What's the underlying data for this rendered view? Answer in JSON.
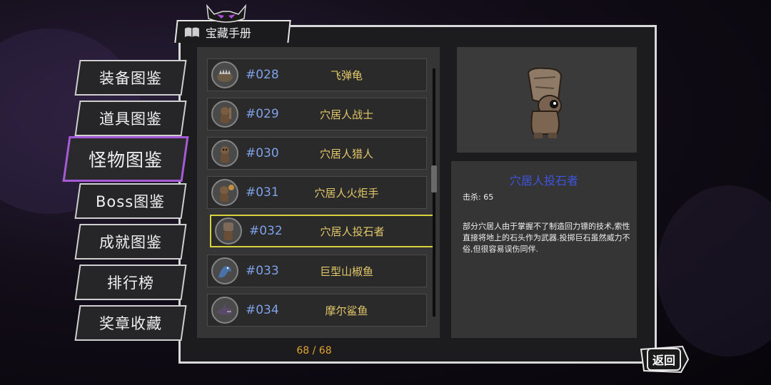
{
  "header": {
    "title": "宝藏手册"
  },
  "nav": {
    "items": [
      {
        "label": "装备图鉴",
        "active": false
      },
      {
        "label": "道具图鉴",
        "active": false
      },
      {
        "label": "怪物图鉴",
        "active": true
      },
      {
        "label": "Boss图鉴",
        "active": false
      },
      {
        "label": "成就图鉴",
        "active": false
      },
      {
        "label": "排行榜",
        "active": false
      },
      {
        "label": "奖章收藏",
        "active": false
      }
    ]
  },
  "monster_list": {
    "rows": [
      {
        "number": "#028",
        "name": "飞弹龟",
        "icon": "turtle-icon"
      },
      {
        "number": "#029",
        "name": "穴居人战士",
        "icon": "caveman-warrior-icon"
      },
      {
        "number": "#030",
        "name": "穴居人猎人",
        "icon": "caveman-hunter-icon"
      },
      {
        "number": "#031",
        "name": "穴居人火炬手",
        "icon": "caveman-torch-icon"
      },
      {
        "number": "#032",
        "name": "穴居人投石者",
        "icon": "caveman-thrower-icon",
        "selected": true
      },
      {
        "number": "#033",
        "name": "巨型山椒鱼",
        "icon": "salamander-icon"
      },
      {
        "number": "#034",
        "name": "摩尔鲨鱼",
        "icon": "shark-icon"
      }
    ],
    "page_count": "68 / 68"
  },
  "detail": {
    "name": "穴居人投石者",
    "kills": "击杀: 65",
    "description": "部分穴居人由于掌握不了制造回力镖的技术,索性直接将地上的石头作为武器.投掷巨石虽然威力不俗,但很容易误伤同伴."
  },
  "back_button": {
    "label": "返回"
  },
  "colors": {
    "accent_selected_nav": "#a55bd6",
    "selected_row_border": "#d6d23c",
    "number_text": "#7fa1e8",
    "name_text": "#e3c86a",
    "detail_name": "#3d55e0",
    "page_count": "#e0a530"
  }
}
